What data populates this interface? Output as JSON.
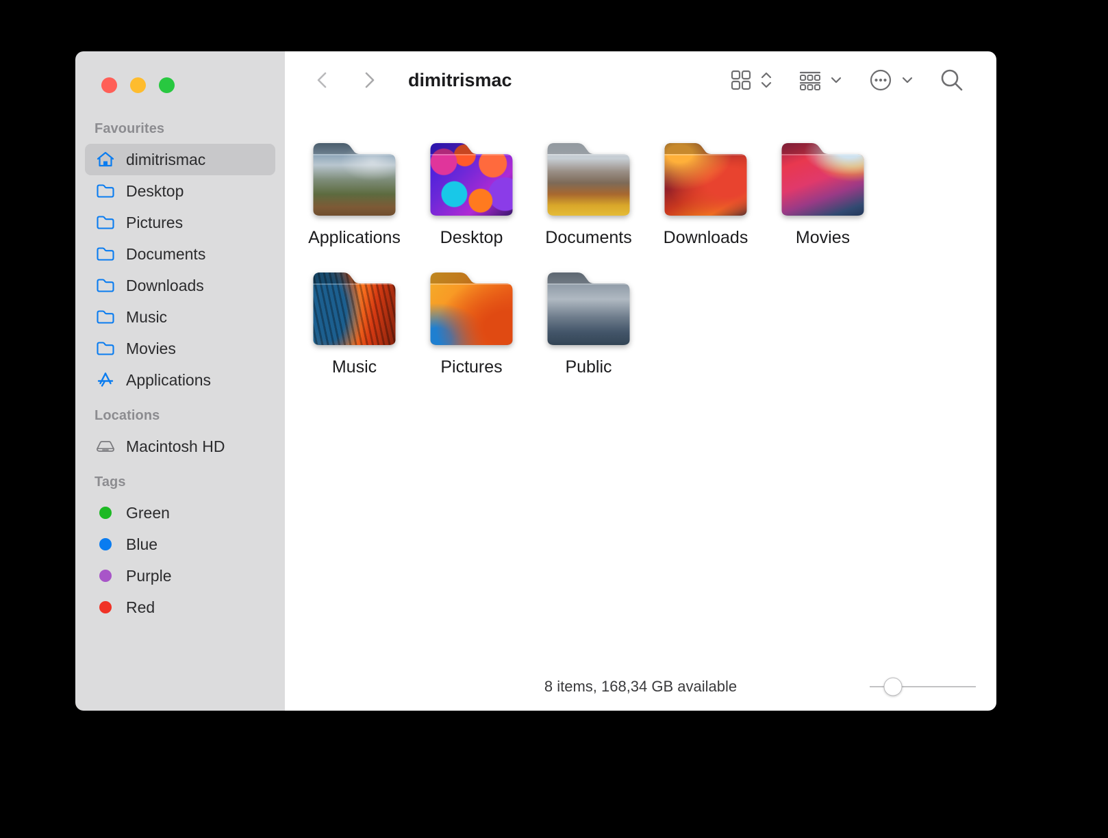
{
  "window": {
    "title": "dimitrismac",
    "traffic_lights": [
      {
        "name": "close",
        "color": "#ff5f57"
      },
      {
        "name": "minimize",
        "color": "#febc2e"
      },
      {
        "name": "maximize",
        "color": "#28c840"
      }
    ]
  },
  "toolbar": {
    "back_icon": "chevron-left",
    "forward_icon": "chevron-right",
    "view_icon": "grid-view-icon",
    "view_chevron": "chevron-up-down",
    "group_icon": "group-by-icon",
    "group_chevron": "chevron-down",
    "more_icon": "ellipsis-circle-icon",
    "more_chevron": "chevron-down",
    "search_icon": "search-icon"
  },
  "sidebar": {
    "sections": [
      {
        "header": "Favourites",
        "items": [
          {
            "label": "dimitrismac",
            "icon": "home-icon",
            "active": true
          },
          {
            "label": "Desktop",
            "icon": "folder-icon",
            "active": false
          },
          {
            "label": "Pictures",
            "icon": "folder-icon",
            "active": false
          },
          {
            "label": "Documents",
            "icon": "folder-icon",
            "active": false
          },
          {
            "label": "Downloads",
            "icon": "folder-icon",
            "active": false
          },
          {
            "label": "Music",
            "icon": "folder-icon",
            "active": false
          },
          {
            "label": "Movies",
            "icon": "folder-icon",
            "active": false
          },
          {
            "label": "Applications",
            "icon": "appstore-icon",
            "active": false
          }
        ]
      },
      {
        "header": "Locations",
        "items": [
          {
            "label": "Macintosh HD",
            "icon": "harddisk-icon",
            "active": false
          }
        ]
      },
      {
        "header": "Tags",
        "items": [
          {
            "label": "Green",
            "icon": "tag-dot",
            "color": "#1db924",
            "active": false
          },
          {
            "label": "Blue",
            "icon": "tag-dot",
            "color": "#0a7cf0",
            "active": false
          },
          {
            "label": "Purple",
            "icon": "tag-dot",
            "color": "#a855c8",
            "active": false
          },
          {
            "label": "Red",
            "icon": "tag-dot",
            "color": "#f03226",
            "active": false
          }
        ]
      }
    ]
  },
  "main": {
    "items": [
      {
        "label": "Applications",
        "art": "art-yosemite"
      },
      {
        "label": "Desktop",
        "art": "art-abstract"
      },
      {
        "label": "Documents",
        "art": "art-highsierra"
      },
      {
        "label": "Downloads",
        "art": "art-ventura-dark"
      },
      {
        "label": "Movies",
        "art": "art-bigsur"
      },
      {
        "label": "Music",
        "art": "art-stripes"
      },
      {
        "label": "Pictures",
        "art": "art-ventura-light"
      },
      {
        "label": "Public",
        "art": "art-elcapitan"
      }
    ]
  },
  "statusbar": {
    "text": "8 items, 168,34 GB available",
    "zoom_value": 22
  }
}
